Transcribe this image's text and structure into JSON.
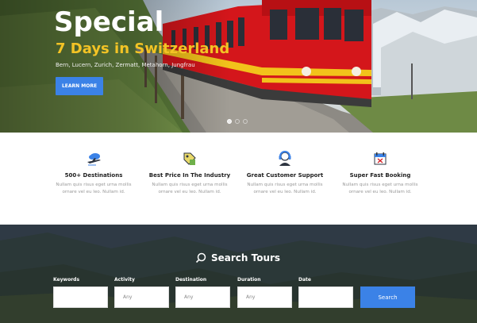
{
  "hero": {
    "title": "Special",
    "subtitle": "7 Days in Switzerland",
    "places": "Bern, Lucern, Zurich, Zermatt, Metahorn, Jungfrau",
    "button_label": "LEARN MORE",
    "slider": {
      "count": 3,
      "active": 1
    }
  },
  "features": [
    {
      "icon": "plane-cloud-icon",
      "title": "500+ Destinations",
      "desc_line1": "Nullam quis risus eget urna mollis",
      "desc_line2": "ornare vel eu leo. Nullam id."
    },
    {
      "icon": "price-tag-icon",
      "title": "Best Price In The Industry",
      "desc_line1": "Nullam quis risus eget urna mollis",
      "desc_line2": "ornare vel eu leo. Nullam id."
    },
    {
      "icon": "headset-support-icon",
      "title": "Great Customer Support",
      "desc_line1": "Nullam quis risus eget urna mollis",
      "desc_line2": "ornare vel eu leo. Nullam id."
    },
    {
      "icon": "calendar-booking-icon",
      "title": "Super Fast Booking",
      "desc_line1": "Nullam quis risus eget urna mollis",
      "desc_line2": "ornare vel eu leo. Nullam id."
    }
  ],
  "search": {
    "title": "Search Tours",
    "fields": [
      {
        "label": "Keywords",
        "value": ""
      },
      {
        "label": "Activity",
        "value": "Any"
      },
      {
        "label": "Destination",
        "value": "Any"
      },
      {
        "label": "Duration",
        "value": "Any"
      },
      {
        "label": "Date",
        "value": ""
      }
    ],
    "button_label": "Search"
  },
  "colors": {
    "accent": "#3b82e7",
    "subtitle_yellow": "#f3c325",
    "train_red": "#d4161b"
  }
}
